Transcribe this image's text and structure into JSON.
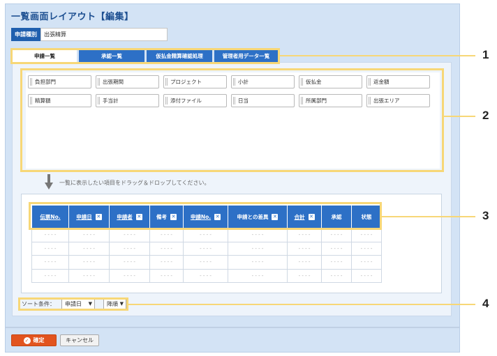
{
  "page": {
    "title": "一覧画面レイアウト【編集】"
  },
  "application_type": {
    "label": "申請種別",
    "value": "出張精算"
  },
  "tabs": [
    {
      "label": "申請一覧",
      "active": true
    },
    {
      "label": "承認一覧",
      "active": false
    },
    {
      "label": "仮払金精算確認処理",
      "active": false
    },
    {
      "label": "管理者用データ一覧",
      "active": false
    }
  ],
  "palette": {
    "items": [
      "負担部門",
      "出張期間",
      "プロジェクト",
      "小計",
      "仮払金",
      "返金額",
      "精算額",
      "手当計",
      "添付ファイル",
      "日当",
      "所属部門",
      "出張エリア"
    ]
  },
  "hint": "一覧に表示したい項目をドラッグ＆ドロップしてください。",
  "table": {
    "columns": [
      {
        "label": "伝票No.",
        "underline": true,
        "removable": false
      },
      {
        "label": "申請日",
        "underline": true,
        "removable": true
      },
      {
        "label": "申請者",
        "underline": true,
        "removable": true
      },
      {
        "label": "備考",
        "underline": false,
        "removable": true
      },
      {
        "label": "申請No.",
        "underline": true,
        "removable": true
      },
      {
        "label": "申請との差異",
        "underline": false,
        "removable": true
      },
      {
        "label": "合計",
        "underline": true,
        "removable": true
      },
      {
        "label": "承認",
        "underline": false,
        "removable": false
      },
      {
        "label": "状態",
        "underline": false,
        "removable": false
      }
    ],
    "placeholder": "- - - -",
    "row_count": 4
  },
  "sort": {
    "label": "ソート条件：",
    "field": "申請日",
    "order": "降順"
  },
  "buttons": {
    "confirm": "確定",
    "cancel": "キャンセル"
  },
  "callouts": [
    "1",
    "2",
    "3",
    "4"
  ],
  "colors": {
    "primary": "#2d70c6",
    "panel_bg": "#d3e3f5",
    "highlight": "#f7d777",
    "confirm": "#e2541f"
  }
}
